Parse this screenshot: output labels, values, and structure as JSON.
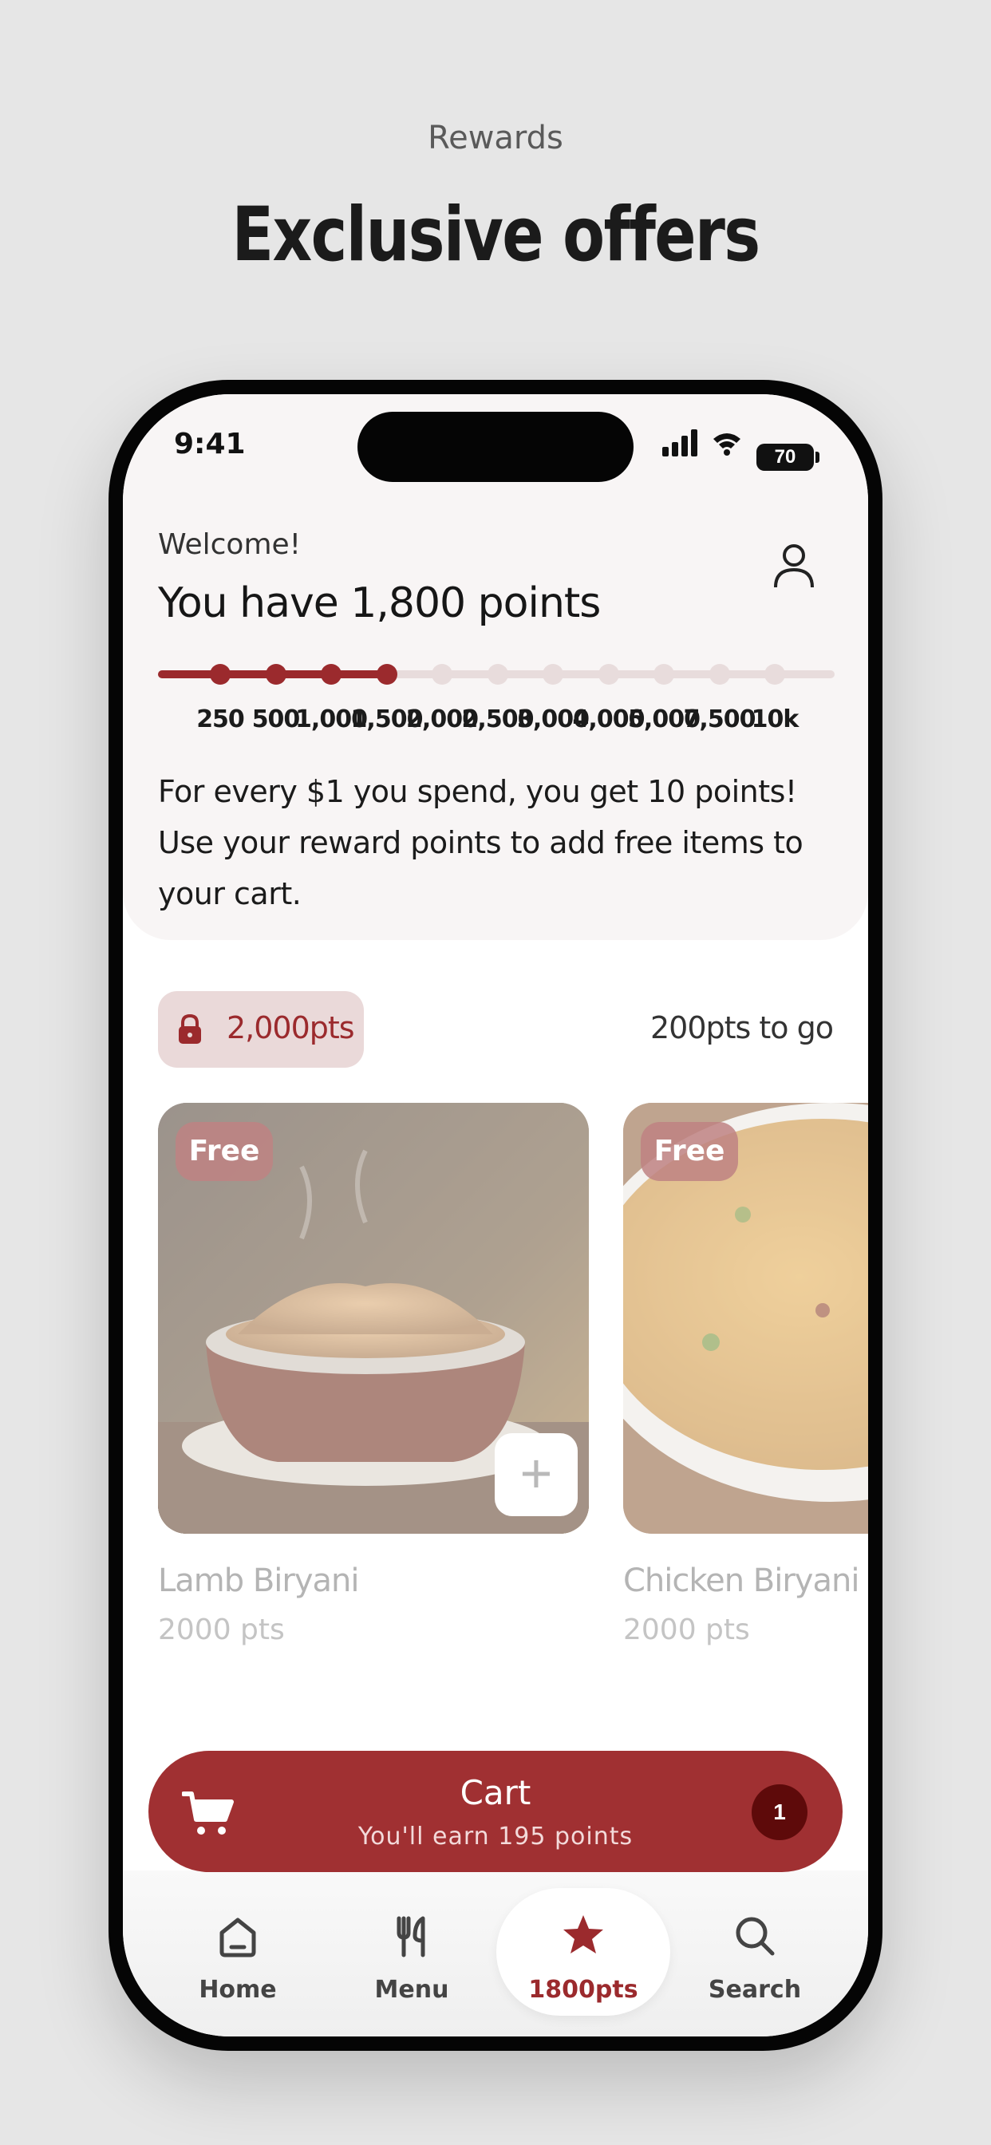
{
  "header": {
    "eyebrow": "Rewards",
    "title": "Exclusive offers"
  },
  "status_bar": {
    "time": "9:41",
    "battery": "70"
  },
  "rewards": {
    "welcome": "Welcome!",
    "points_title": "You have 1,800 points",
    "progress": {
      "tiers": [
        "250",
        "500",
        "1,000",
        "1,500",
        "2,000",
        "2,500",
        "3,000",
        "4,000",
        "5,000",
        "7,500",
        "10k"
      ],
      "reached_count": 4,
      "current_points": 1800
    },
    "earn_text": "For every $1 you spend, you get 10 points! Use your reward points to add free items to your cart."
  },
  "tier_section": {
    "badge": "2,000pts",
    "to_go": "200pts to go"
  },
  "items": [
    {
      "tag": "Free",
      "name": "Lamb Biryani",
      "points": "2000 pts",
      "add_label": "+"
    },
    {
      "tag": "Free",
      "name": "Chicken Biryani",
      "points": "2000 pts"
    }
  ],
  "cart": {
    "title": "Cart",
    "subtitle": "You'll earn 195 points",
    "count": "1"
  },
  "tabs": [
    {
      "label": "Home",
      "icon": "home-icon"
    },
    {
      "label": "Menu",
      "icon": "utensils-icon"
    },
    {
      "label": "1800pts",
      "icon": "star-icon",
      "active": true
    },
    {
      "label": "Search",
      "icon": "search-icon"
    }
  ],
  "colors": {
    "accent": "#9b2a2d",
    "cart": "#a03032",
    "badge_bg": "#ead9d9"
  }
}
